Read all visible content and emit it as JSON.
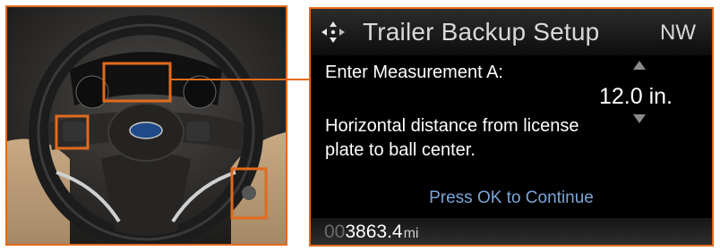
{
  "display": {
    "title": "Trailer Backup Setup",
    "compass": "NW",
    "prompt": "Enter Measurement A:",
    "value": "12.0 in.",
    "description": "Horizontal distance from license plate to ball center.",
    "action": "Press OK to Continue",
    "odometer_lead": "00",
    "odometer_main": "3863.4",
    "odometer_unit": "mi"
  },
  "colors": {
    "accent": "#e26a1c",
    "action_text": "#7aa6d8"
  },
  "icons": [
    "four-way-nav-icon",
    "up-arrow-icon",
    "down-arrow-icon",
    "ford-logo"
  ]
}
